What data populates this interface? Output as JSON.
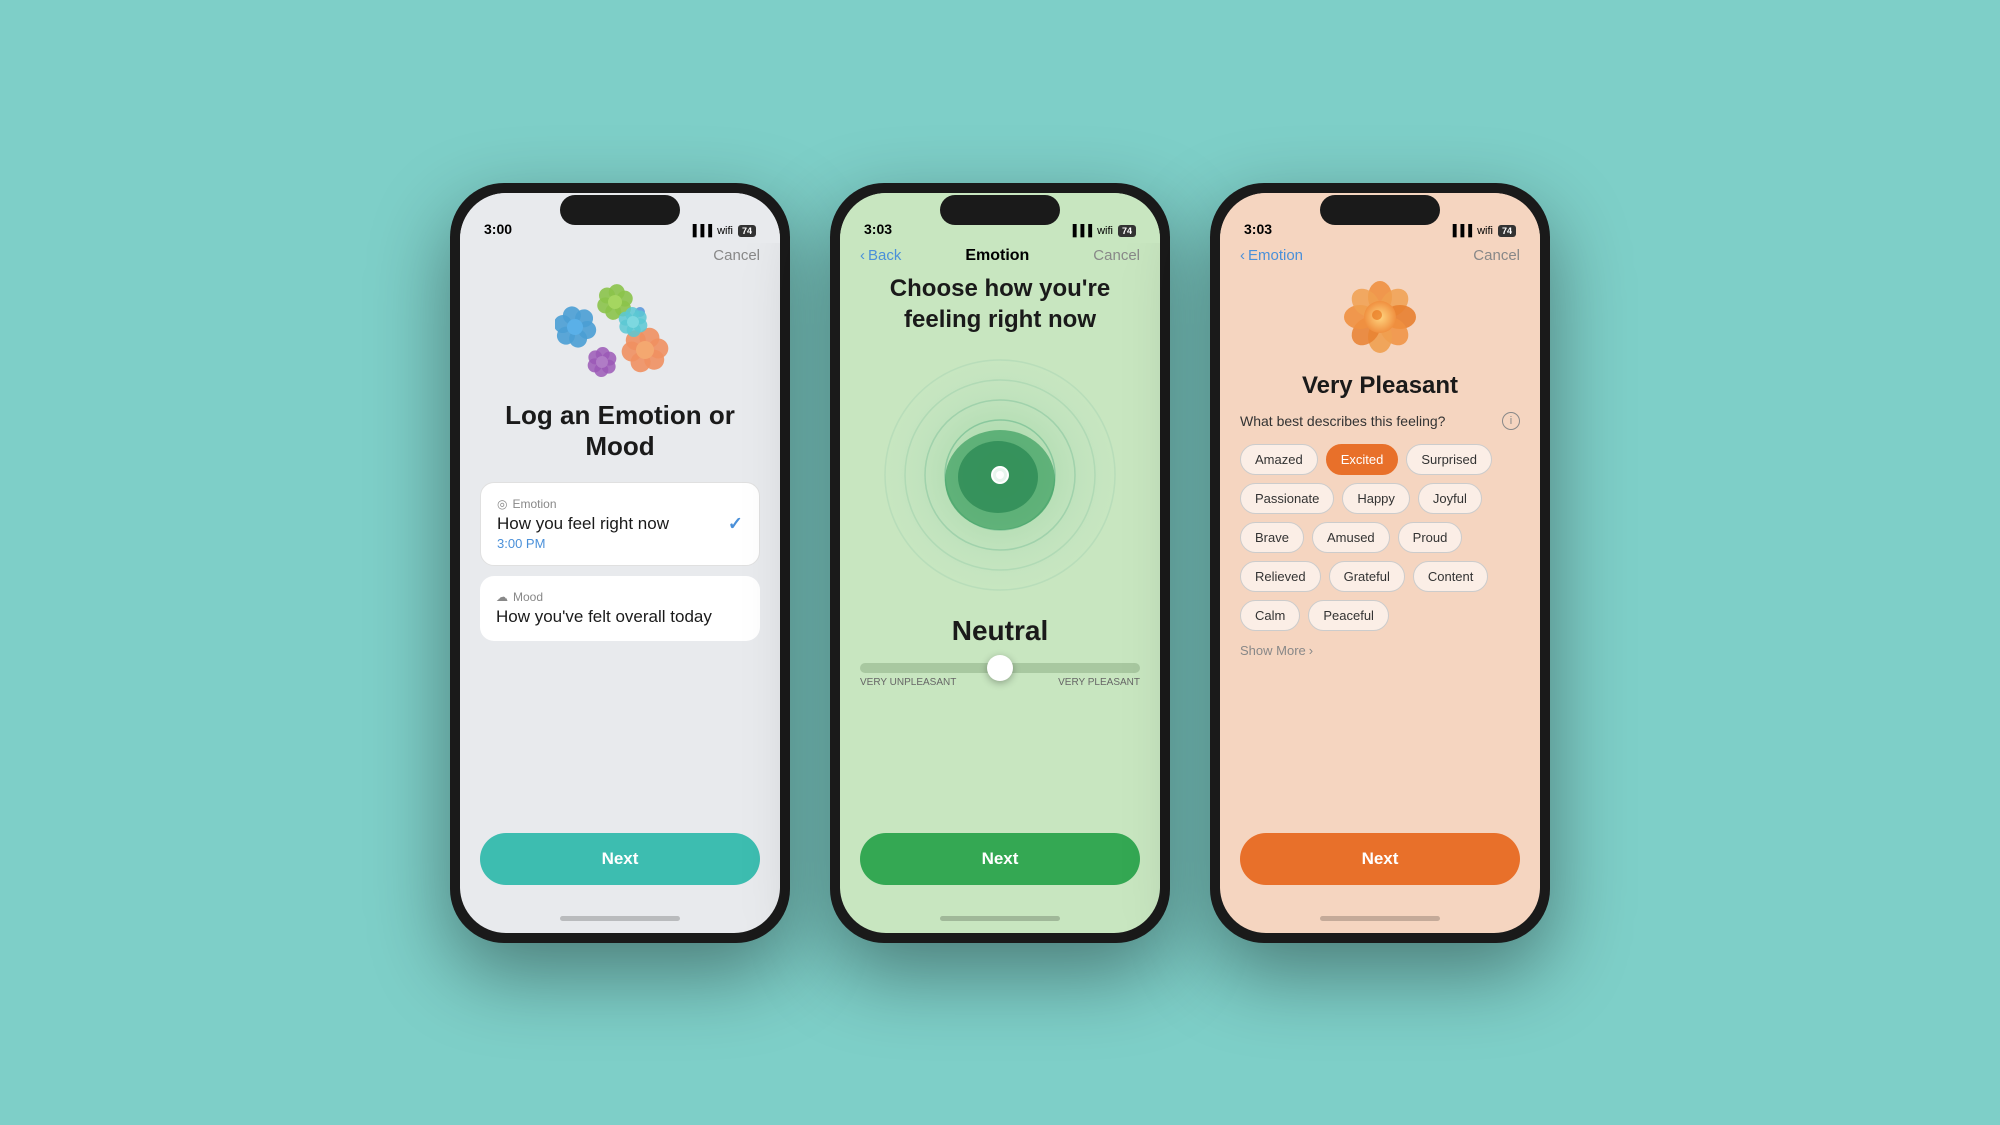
{
  "background_color": "#7ecfc8",
  "phone1": {
    "status_time": "3:00",
    "nav": {
      "cancel_label": "Cancel"
    },
    "title": "Log an Emotion\nor Mood",
    "options": [
      {
        "type": "Emotion",
        "label": "How you feel right now",
        "time": "3:00 PM",
        "selected": true
      },
      {
        "type": "Mood",
        "label": "How you've felt overall today",
        "selected": false
      }
    ],
    "next_label": "Next"
  },
  "phone2": {
    "status_time": "3:03",
    "nav": {
      "back_label": "Back",
      "title": "Emotion",
      "cancel_label": "Cancel"
    },
    "title": "Choose how you're feeling\nright now",
    "emotion_label": "Neutral",
    "slider": {
      "left_label": "VERY UNPLEASANT",
      "right_label": "VERY PLEASANT",
      "position": 50
    },
    "next_label": "Next"
  },
  "phone3": {
    "status_time": "3:03",
    "nav": {
      "back_label": "Emotion",
      "cancel_label": "Cancel"
    },
    "pleasant_label": "Very Pleasant",
    "question": "What best describes this feeling?",
    "feelings": [
      {
        "label": "Amazed",
        "selected": false
      },
      {
        "label": "Excited",
        "selected": true
      },
      {
        "label": "Surprised",
        "selected": false
      },
      {
        "label": "Passionate",
        "selected": false
      },
      {
        "label": "Happy",
        "selected": false
      },
      {
        "label": "Joyful",
        "selected": false
      },
      {
        "label": "Brave",
        "selected": false
      },
      {
        "label": "Amused",
        "selected": false
      },
      {
        "label": "Proud",
        "selected": false
      },
      {
        "label": "Relieved",
        "selected": false
      },
      {
        "label": "Grateful",
        "selected": false
      },
      {
        "label": "Content",
        "selected": false
      },
      {
        "label": "Calm",
        "selected": false
      },
      {
        "label": "Peaceful",
        "selected": false
      }
    ],
    "show_more_label": "Show More",
    "next_label": "Next"
  },
  "icons": {
    "chevron_left": "‹",
    "checkmark": "✓",
    "info": "i",
    "chevron_right": "›"
  }
}
